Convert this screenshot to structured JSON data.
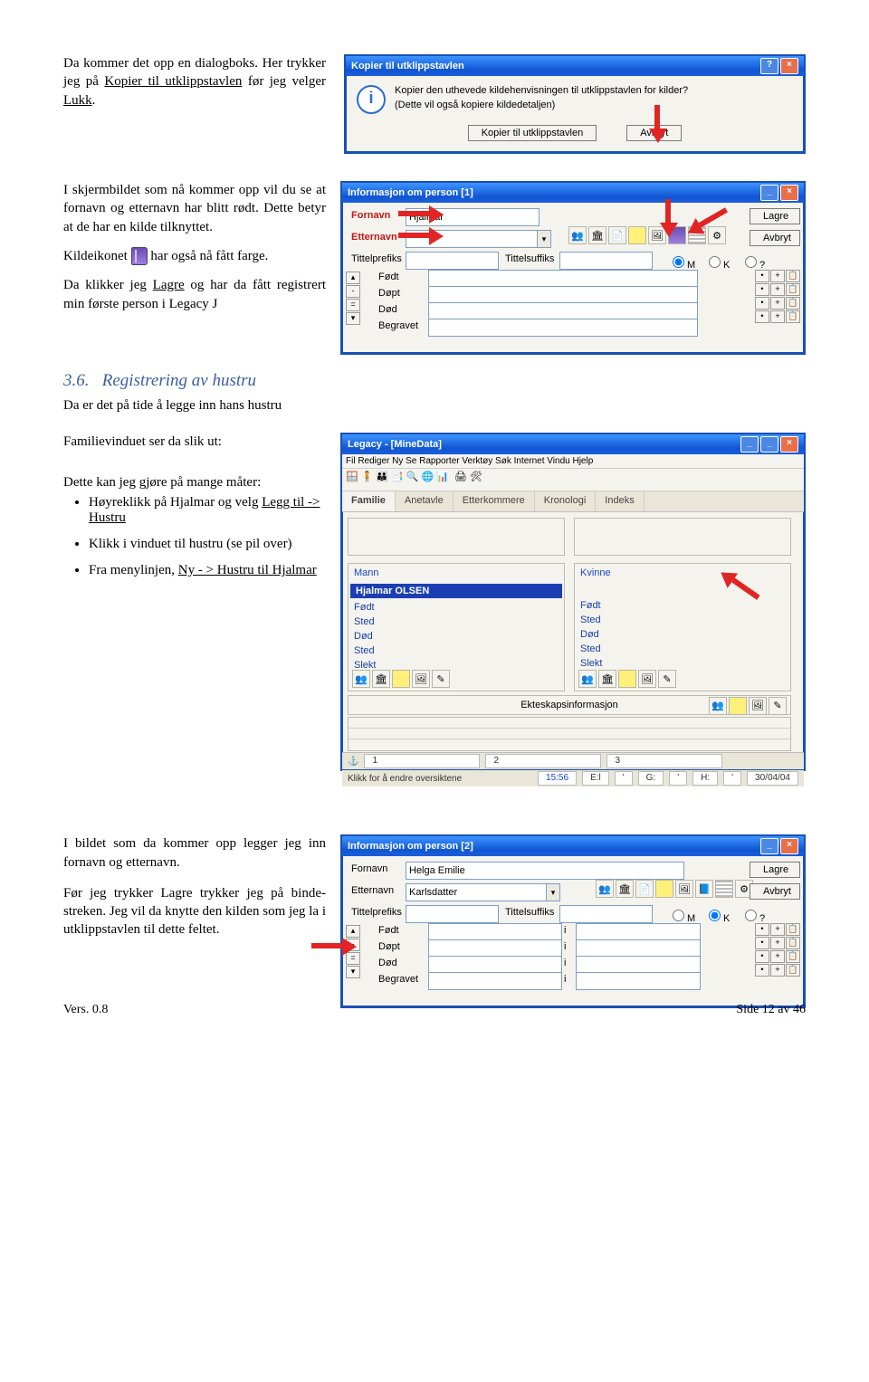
{
  "para1": {
    "a": "Da kommer det opp en dialogboks. Her trykker jeg på ",
    "b": "Kopier til utklippstavlen",
    "c": " før jeg velger ",
    "d": "Lukk",
    "e": "."
  },
  "dialog": {
    "title": "Kopier til utklippstavlen",
    "line1": "Kopier den uthevede kildehenvisningen til utklippstavlen for kilder?",
    "line2": "(Dette vil også kopiere kildedetaljen)",
    "btn_copy": "Kopier til utklippstavlen",
    "btn_cancel": "Avbryt"
  },
  "para2": "I skjermbildet som nå kommer opp vil du se at fornavn og etternavn har blitt rødt. Dette betyr at de har en kilde tilknyttet.",
  "para3a": "Kildeikonet ",
  "para3b": " har også nå fått farge.",
  "para4": {
    "a": "Da klikker jeg ",
    "b": "Lagre",
    "c": " og har da fått registrert min første person i Legacy J"
  },
  "info1": {
    "title": "Informasjon om person [1]",
    "fornavn": "Fornavn",
    "fornavn_val": "Hjalmar",
    "etternavn": "Etternavn",
    "tittelprefiks": "Tittelprefiks",
    "tittelsuffiks": "Tittelsuffiks",
    "fodt": "Født",
    "dopt": "Døpt",
    "dod": "Død",
    "begravet": "Begravet",
    "m": "M",
    "k": "K",
    "q": "?",
    "lagre": "Lagre",
    "avbryt": "Avbryt"
  },
  "sec36_num": "3.6.",
  "sec36_title": "Registrering av hustru",
  "sec36_intro": "Da er det på tide å legge inn hans hustru",
  "para5": "Familievinduet ser da slik ut:",
  "para6": "Dette kan jeg gjøre på mange måter:",
  "bullets": {
    "b1a": "Høyreklikk på Hjalmar og velg ",
    "b1b": "Legg til -> Hustru",
    "b2": "Klikk i vinduet til hustru (se pil over)",
    "b3a": "Fra menylinjen, ",
    "b3b": "Ny - > Hustru til Hjalmar"
  },
  "legacy": {
    "title": "Legacy - [MineData]",
    "menu": "Fil Rediger Ny Se Rapporter Verktøy Søk Internet Vindu Hjelp",
    "tabs": [
      "Familie",
      "Anetavle",
      "Etterkommere",
      "Kronologi",
      "Indeks"
    ],
    "mann": "Mann",
    "kvinne": "Kvinne",
    "person": "Hjalmar OLSEN",
    "fodt": "Født",
    "sted": "Sted",
    "dod": "Død",
    "slekt": "Slekt",
    "ektesk": "Ekteskapsinformasjon",
    "status_hint": "Klikk for å endre oversiktene",
    "s_time": "15:56",
    "s_e": "E:l",
    "s_g": "G:",
    "s_h": "H:",
    "s_date": "30/04/04"
  },
  "para7": "I bildet som da kommer opp legger jeg inn fornavn og etternavn.",
  "para8": "Før jeg trykker Lagre trykker jeg på binde-streken. Jeg vil da knytte den kilden som jeg la i utklippstavlen til dette feltet.",
  "info2": {
    "title": "Informasjon om person [2]",
    "fornavn": "Fornavn",
    "fornavn_val": "Helga Emilie",
    "etternavn": "Etternavn",
    "etternavn_val": "Karlsdatter",
    "tittelprefiks": "Tittelprefiks",
    "tittelsuffiks": "Tittelsuffiks",
    "fodt": "Født",
    "dopt": "Døpt",
    "dod": "Død",
    "begravet": "Begravet",
    "i": "i",
    "m": "M",
    "k": "K",
    "q": "?",
    "lagre": "Lagre",
    "avbryt": "Avbryt"
  },
  "footer_left": "Vers. 0.8",
  "footer_right": "Side 12 av 46"
}
